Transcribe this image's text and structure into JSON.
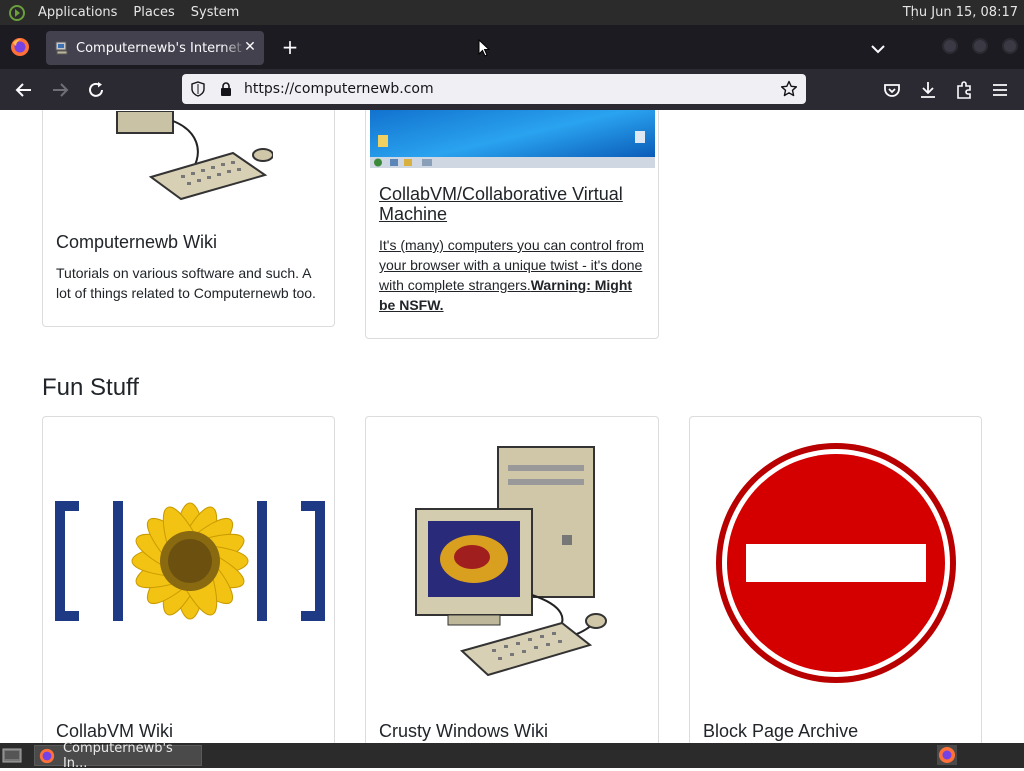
{
  "panel": {
    "applications": "Applications",
    "places": "Places",
    "system": "System",
    "clock": "Thu Jun 15, 08:17"
  },
  "browser": {
    "tab_title": "Computernewb's Internet Pl",
    "url": "https://computernewb.com"
  },
  "page": {
    "top_cards": [
      {
        "title": "Computernewb Wiki",
        "text": "Tutorials on various software and such. A lot of things related to Computernewb too."
      },
      {
        "title": "CollabVM/Collaborative Virtual Machine",
        "text": "It's (many) computers you can control from your browser with a unique twist - it's done with complete strangers.",
        "warning": "Warning: Might be NSFW."
      }
    ],
    "section_heading": "Fun Stuff",
    "fun_cards": [
      {
        "title": "CollabVM Wiki",
        "image": "sunflower-logo"
      },
      {
        "title": "Crusty Windows Wiki",
        "image": "retro-computer"
      },
      {
        "title": "Block Page Archive",
        "image": "no-entry-sign"
      }
    ]
  },
  "taskbar": {
    "task_label": "Computernewb's In..."
  },
  "colors": {
    "panel_bg": "#2b2b2b",
    "tabstrip_bg": "#1c1b22",
    "toolbar_bg": "#2b2a33",
    "urlbar_bg": "#f0f0f4",
    "no_entry_red": "#d40000"
  }
}
